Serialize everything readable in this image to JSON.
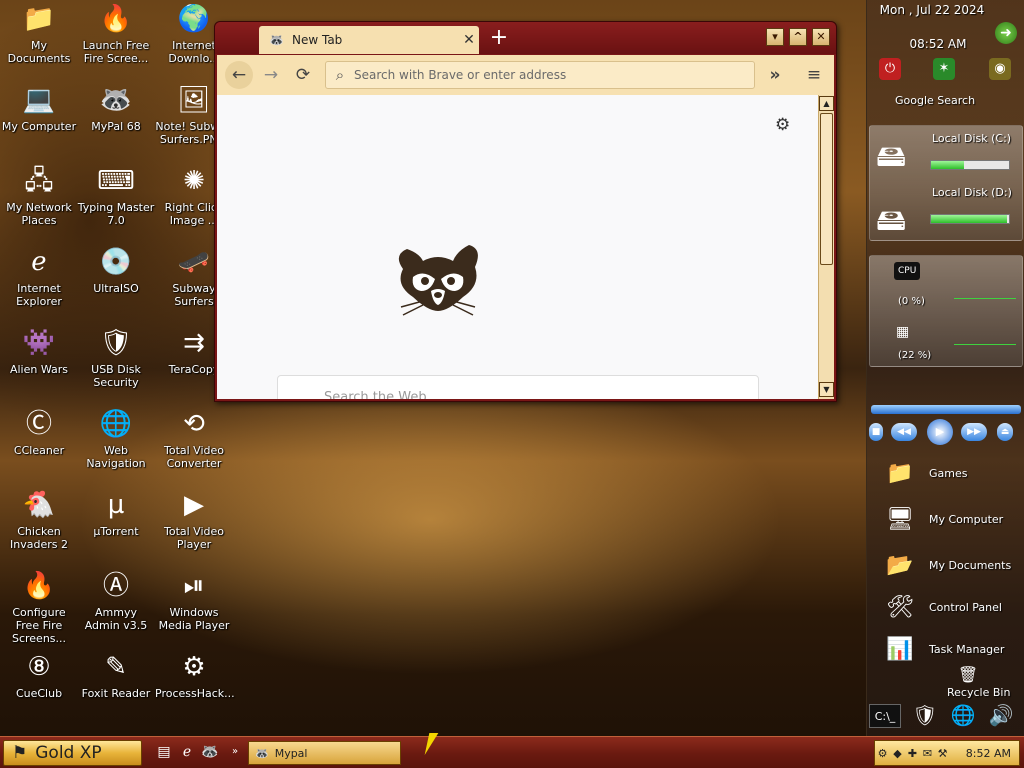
{
  "desktop": {
    "icons": [
      {
        "label": "My Documents",
        "icon": "folder-documents-icon"
      },
      {
        "label": "Launch Free Fire Scree...",
        "icon": "fire-screensaver-icon"
      },
      {
        "label": "Internet Downlo...",
        "icon": "download-manager-icon"
      },
      {
        "label": "My Computer",
        "icon": "computer-icon"
      },
      {
        "label": "MyPal 68",
        "icon": "mypal-raccoon-icon"
      },
      {
        "label": "Note! Subway Surfers.PN...",
        "icon": "image-file-icon"
      },
      {
        "label": "My Network Places",
        "icon": "network-places-icon"
      },
      {
        "label": "Typing Master 7.0",
        "icon": "typing-master-icon"
      },
      {
        "label": "Right Click Image ...",
        "icon": "gear-flower-icon"
      },
      {
        "label": "Internet Explorer",
        "icon": "internet-explorer-icon"
      },
      {
        "label": "UltraISO",
        "icon": "disc-icon"
      },
      {
        "label": "Subway Surfers",
        "icon": "subway-surfers-icon"
      },
      {
        "label": "Alien Wars",
        "icon": "alien-wars-icon"
      },
      {
        "label": "USB Disk Security",
        "icon": "shield-icon"
      },
      {
        "label": "TeraCopy",
        "icon": "teracopy-icon"
      },
      {
        "label": "CCleaner",
        "icon": "ccleaner-icon"
      },
      {
        "label": "Web Navigation",
        "icon": "globe-icon"
      },
      {
        "label": "Total Video Converter",
        "icon": "video-converter-icon"
      },
      {
        "label": "Chicken Invaders 2",
        "icon": "chicken-icon"
      },
      {
        "label": "µTorrent",
        "icon": "utorrent-icon"
      },
      {
        "label": "Total Video Player",
        "icon": "play-icon"
      },
      {
        "label": "Configure Free Fire Screens...",
        "icon": "fire-config-icon"
      },
      {
        "label": "Ammyy Admin v3.5",
        "icon": "ammyy-icon"
      },
      {
        "label": "Windows Media Player",
        "icon": "media-player-icon"
      },
      {
        "label": "CueClub",
        "icon": "billiard-ball-icon"
      },
      {
        "label": "Foxit Reader",
        "icon": "foxit-icon"
      },
      {
        "label": "ProcessHack...",
        "icon": "process-hacker-icon"
      }
    ]
  },
  "browser": {
    "tab_title": "New Tab",
    "tab_close": "✕",
    "new_tab": "+",
    "address_placeholder": "Search with Brave or enter address",
    "search_card_text": "Search the Web",
    "window_buttons": {
      "minimize": "▾",
      "maximize": "^",
      "close": "✕"
    }
  },
  "sidebar": {
    "date": "Mon , Jul 22 2024",
    "time": "08:52 AM",
    "google_search": "Google Search",
    "disks": [
      {
        "label": "Local Disk (C:)",
        "used_fraction": 0.42
      },
      {
        "label": "Local Disk (D:)",
        "used_fraction": 0.98
      }
    ],
    "cpu": {
      "label": "CPU",
      "value": "(0 %)"
    },
    "ram": {
      "value": "(22 %)"
    },
    "items": [
      {
        "label": "Games",
        "icon": "games-folder-icon"
      },
      {
        "label": "My Computer",
        "icon": "computer-icon"
      },
      {
        "label": "My Documents",
        "icon": "folder-documents-icon"
      },
      {
        "label": "Control Panel",
        "icon": "control-panel-icon"
      },
      {
        "label": "Task Manager",
        "icon": "task-manager-icon"
      },
      {
        "label": "Recycle Bin",
        "icon": "recycle-bin-icon"
      }
    ]
  },
  "taskbar": {
    "start_label": "Gold XP",
    "task_label": "Mypal",
    "clock": "8:52 AM"
  }
}
